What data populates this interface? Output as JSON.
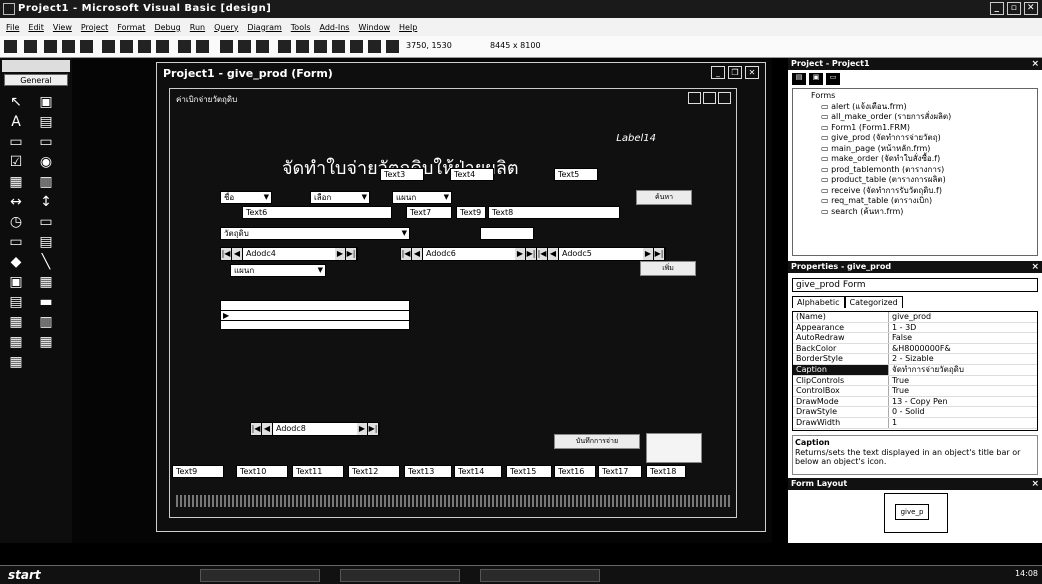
{
  "app": {
    "title": "Project1 - Microsoft Visual Basic [design]"
  },
  "menu": [
    "File",
    "Edit",
    "View",
    "Project",
    "Format",
    "Debug",
    "Run",
    "Query",
    "Diagram",
    "Tools",
    "Add-Ins",
    "Window",
    "Help"
  ],
  "toolbar": {
    "position": "3750, 1530",
    "size": "8445 x 8100"
  },
  "toolbox": {
    "tab": "General"
  },
  "form_window": {
    "title": "Project1 - give_prod (Form)"
  },
  "form": {
    "caption": "ค่าเบิกจ่ายวัตถุดิบ",
    "label_right": "Label14",
    "heading": "จัดทำใบจ่ายวัตถุดิบให้ฝ่ายผลิต",
    "text_top": [
      "Text3",
      "Text4",
      "Text5"
    ],
    "combo1": "ชื่อ",
    "combo2": "เลือก",
    "combo3": "แผนก",
    "combo4": "วัตถุดิบ",
    "combo5": "แผนก",
    "text_row2": [
      "Text6",
      "Text7",
      "Text9",
      "Text8"
    ],
    "btn_search": "ค้นหา",
    "btn_add": "เพิ่ม",
    "btn_save": "บันทึกการจ่าย",
    "adodcs": [
      "Adodc4",
      "Adodc6",
      "Adodc5",
      "Adodc8"
    ],
    "text_bottom": [
      "Text9",
      "Text10",
      "Text11",
      "Text12",
      "Text13",
      "Text14",
      "Text15",
      "Text16",
      "Text17",
      "Text18"
    ]
  },
  "project": {
    "title": "Project - Project1",
    "forms_node": "Forms",
    "items": [
      "alert (แจ้งเตือน.frm)",
      "all_make_order (รายการสั่งผลิต)",
      "Form1 (Form1.FRM)",
      "give_prod (จัดทำการจ่ายวัตถุ)",
      "main_page (หน้าหลัก.frm)",
      "make_order (จัดทำใบสั่งซื้อ.f)",
      "prod_tablemonth (ตารางการ)",
      "product_table (ตารางการผลิต)",
      "receive (จัดทำการรับวัตถุดิบ.f)",
      "req_mat_table (ตารางเบิก)",
      "search (ค้นหา.frm)"
    ]
  },
  "properties": {
    "title": "Properties - give_prod",
    "object": "give_prod  Form",
    "tabs": [
      "Alphabetic",
      "Categorized"
    ],
    "rows": [
      {
        "k": "(Name)",
        "v": "give_prod"
      },
      {
        "k": "Appearance",
        "v": "1 - 3D"
      },
      {
        "k": "AutoRedraw",
        "v": "False"
      },
      {
        "k": "BackColor",
        "v": "&H8000000F&"
      },
      {
        "k": "BorderStyle",
        "v": "2 - Sizable"
      },
      {
        "k": "Caption",
        "v": "จัดทำการจ่ายวัตถุดิบ"
      },
      {
        "k": "ClipControls",
        "v": "True"
      },
      {
        "k": "ControlBox",
        "v": "True"
      },
      {
        "k": "DrawMode",
        "v": "13 - Copy Pen"
      },
      {
        "k": "DrawStyle",
        "v": "0 - Solid"
      },
      {
        "k": "DrawWidth",
        "v": "1"
      }
    ],
    "desc_title": "Caption",
    "desc_text": "Returns/sets the text displayed in an object's title bar or below an object's icon."
  },
  "form_layout": {
    "title": "Form Layout",
    "preview": "give_p"
  },
  "taskbar": {
    "start": "start",
    "time": "14:08"
  }
}
